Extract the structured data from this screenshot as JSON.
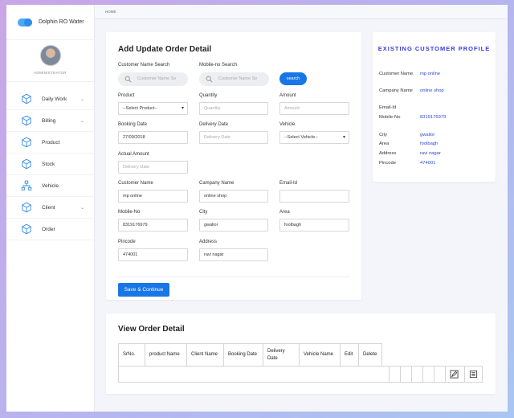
{
  "app": {
    "brand": "Dolphin RO Water",
    "role": "ADMINISTRATOR"
  },
  "breadcrumb": "HOME",
  "sidebar": {
    "items": [
      {
        "label": "Daily Work",
        "icon": "cube-icon",
        "has_submenu": true
      },
      {
        "label": "Billing",
        "icon": "cube-icon",
        "has_submenu": true
      },
      {
        "label": "Product",
        "icon": "cube-icon",
        "has_submenu": false
      },
      {
        "label": "Stock",
        "icon": "cube-icon",
        "has_submenu": false
      },
      {
        "label": "Vehicle",
        "icon": "hierarchy-icon",
        "has_submenu": false
      },
      {
        "label": "Client",
        "icon": "cube-icon",
        "has_submenu": true
      },
      {
        "label": "Order",
        "icon": "cube-icon",
        "has_submenu": false
      }
    ]
  },
  "order_form": {
    "title": "Add Update Order Detail",
    "customer_search": {
      "label": "Customer Name Search",
      "placeholder": "Customer Name Se"
    },
    "mobile_search": {
      "label": "Mobile-no Search",
      "placeholder": "Customer Name Se"
    },
    "search_button": "search",
    "product": {
      "label": "Product",
      "value": "--Select Product--"
    },
    "quantity": {
      "label": "Quantity",
      "placeholder": "Quantity"
    },
    "amount": {
      "label": "Amount",
      "placeholder": "Amount"
    },
    "booking_date": {
      "label": "Booking Date",
      "value": "27/09/2018"
    },
    "delivery_date": {
      "label": "Delivery Date",
      "placeholder": "Delivery Date"
    },
    "vehicle": {
      "label": "Vehicle",
      "value": "--Select Vehicle--"
    },
    "actual_amount": {
      "label": "Actual Amount",
      "placeholder": "Delivery Date"
    },
    "customer_name": {
      "label": "Customer Name",
      "value": "mp online"
    },
    "company_name": {
      "label": "Campany Name",
      "value": "online shop"
    },
    "email": {
      "label": "Email-Id",
      "value": ""
    },
    "mobile": {
      "label": "Mobile-No",
      "value": "8319176979"
    },
    "city": {
      "label": "City",
      "value": "gwalior"
    },
    "area": {
      "label": "Area",
      "value": "foolbagh"
    },
    "pincode": {
      "label": "Pincode",
      "value": "474001"
    },
    "address": {
      "label": "Address",
      "value": "ravi nagar"
    },
    "save_button": "Save & Continue"
  },
  "existing_customer": {
    "title": "EXISTING CUSTOMER PROFILE",
    "rows": [
      {
        "label": "Customer Name",
        "value": "mp online"
      },
      {
        "label": "Campany Name",
        "value": "online shop"
      },
      {
        "label": "Email-Id",
        "value": ""
      },
      {
        "label": "Mobile-No",
        "value": "8319176979"
      },
      {
        "label": "City",
        "value": "gwalior"
      },
      {
        "label": "Area",
        "value": "foolbagh"
      },
      {
        "label": "Address",
        "value": "ravi nagar"
      },
      {
        "label": "Pincode",
        "value": "474001"
      }
    ]
  },
  "order_table": {
    "title": "View Order Detail",
    "columns": [
      "SrNo.",
      "product Name",
      "Client Name",
      "Booking Date",
      "Delivery Date",
      "Vehicle Name",
      "Edit",
      "Delete"
    ],
    "actions": {
      "edit_icon": "edit-icon",
      "delete_icon": "delete-icon"
    }
  },
  "colors": {
    "accent": "#1976e6",
    "profile_title": "#3c3ce6",
    "profile_value": "#2b48d8"
  }
}
